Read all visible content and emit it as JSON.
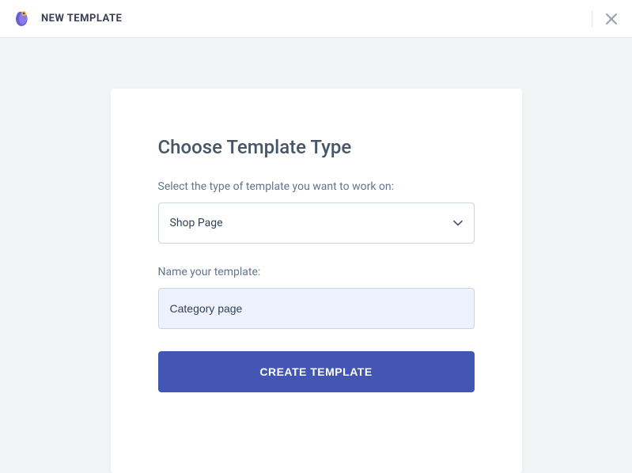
{
  "header": {
    "title": "NEW TEMPLATE"
  },
  "card": {
    "title": "Choose Template Type",
    "type_label": "Select the type of template you want to work on:",
    "type_value": "Shop Page",
    "name_label": "Name your template:",
    "name_value": "Category page",
    "create_label": "CREATE TEMPLATE"
  }
}
